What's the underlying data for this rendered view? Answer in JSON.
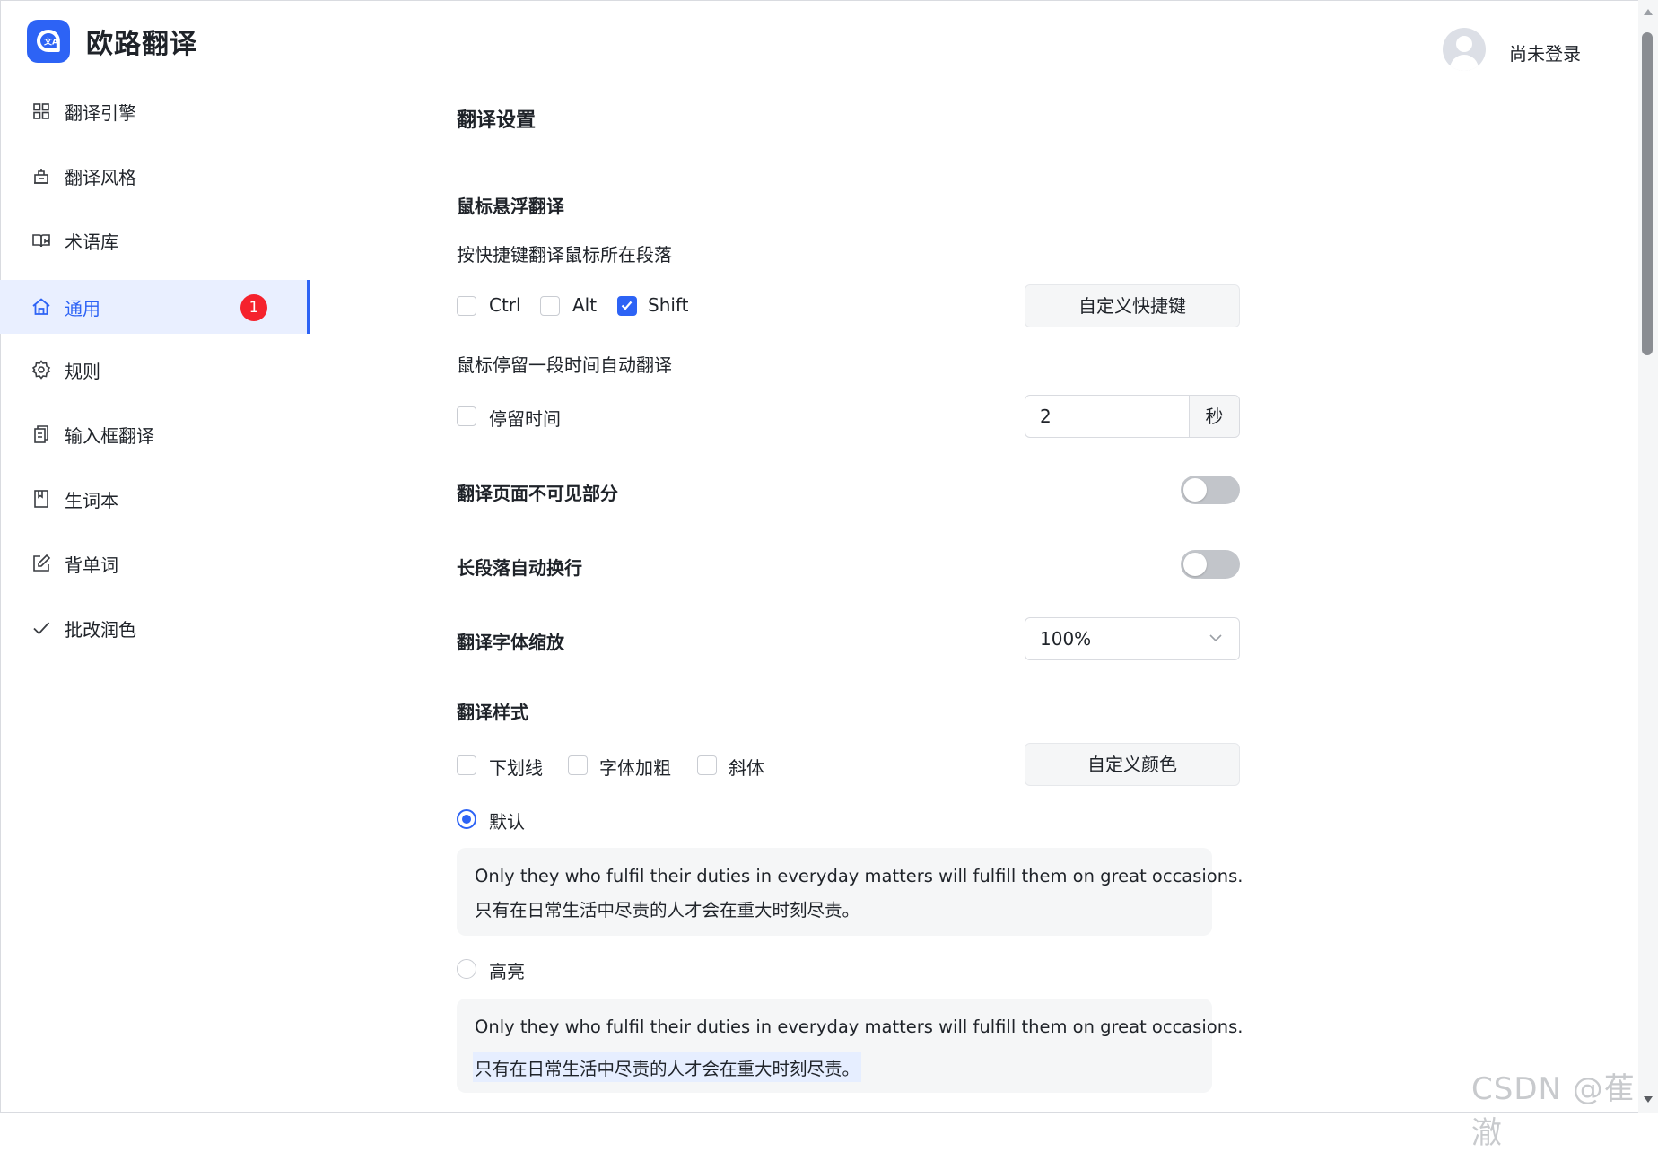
{
  "app": {
    "title": "欧路翻译"
  },
  "user": {
    "status": "尚未登录"
  },
  "sidebar": {
    "items": [
      {
        "label": "翻译引擎",
        "icon": "grid-icon"
      },
      {
        "label": "翻译风格",
        "icon": "style-icon"
      },
      {
        "label": "术语库",
        "icon": "book-open-icon"
      },
      {
        "label": "通用",
        "icon": "home-icon",
        "active": true,
        "badge": "1"
      },
      {
        "label": "规则",
        "icon": "gear-icon"
      },
      {
        "label": "输入框翻译",
        "icon": "clipboard-icon"
      },
      {
        "label": "生词本",
        "icon": "notebook-icon"
      },
      {
        "label": "背单词",
        "icon": "edit-icon"
      },
      {
        "label": "批改润色",
        "icon": "check-icon"
      }
    ]
  },
  "main": {
    "title": "翻译设置",
    "hover": {
      "heading": "鼠标悬浮翻译",
      "shortcut_desc": "按快捷键翻译鼠标所在段落",
      "keys": [
        {
          "label": "Ctrl",
          "checked": false
        },
        {
          "label": "Alt",
          "checked": false
        },
        {
          "label": "Shift",
          "checked": true
        }
      ],
      "custom_shortcut_button": "自定义快捷键",
      "dwell_desc": "鼠标停留一段时间自动翻译",
      "dwell_checkbox": {
        "label": "停留时间",
        "checked": false
      },
      "dwell_value": "2",
      "dwell_unit": "秒"
    },
    "invisible": {
      "label": "翻译页面不可见部分",
      "on": false
    },
    "wrap": {
      "label": "长段落自动换行",
      "on": false
    },
    "font_scale": {
      "label": "翻译字体缩放",
      "value": "100%"
    },
    "style": {
      "heading": "翻译样式",
      "options": [
        {
          "label": "下划线",
          "checked": false
        },
        {
          "label": "字体加粗",
          "checked": false
        },
        {
          "label": "斜体",
          "checked": false
        }
      ],
      "custom_color_button": "自定义颜色",
      "radios": [
        {
          "label": "默认",
          "selected": true,
          "sample_en": "Only they who fulfil their duties in everyday matters will fulfill them on great occasions.",
          "sample_zh": "只有在日常生活中尽责的人才会在重大时刻尽责。"
        },
        {
          "label": "高亮",
          "selected": false,
          "sample_en": "Only they who fulfil their duties in everyday matters will fulfill them on great occasions.",
          "sample_zh": "只有在日常生活中尽责的人才会在重大时刻尽责。"
        }
      ]
    }
  },
  "watermark": "CSDN @萑澈",
  "colors": {
    "accent": "#2d63f5",
    "badge": "#f5222d",
    "highlight": "#e6eeff"
  }
}
